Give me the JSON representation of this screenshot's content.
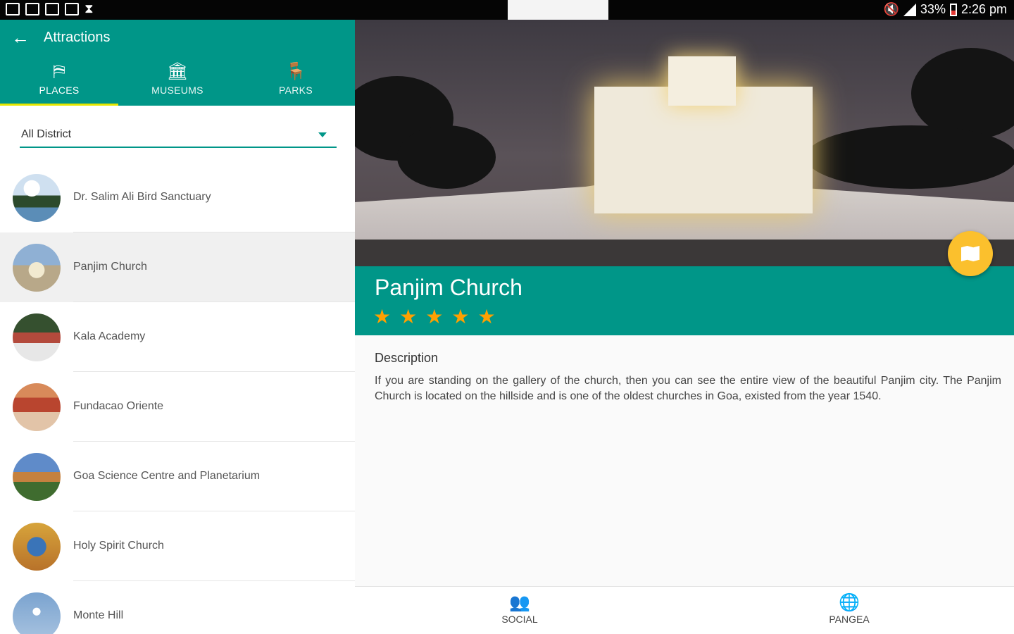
{
  "status": {
    "battery": "33%",
    "time": "2:26 pm"
  },
  "appbar": {
    "title": "Attractions"
  },
  "tabs": [
    {
      "label": "PLACES",
      "icon": "signpost-icon",
      "active": true
    },
    {
      "label": "MUSEUMS",
      "icon": "museum-icon",
      "active": false
    },
    {
      "label": "PARKS",
      "icon": "bench-icon",
      "active": false
    }
  ],
  "filter": {
    "selected": "All District"
  },
  "places": [
    {
      "name": "Dr. Salim Ali Bird Sanctuary"
    },
    {
      "name": "Panjim Church"
    },
    {
      "name": "Kala Academy"
    },
    {
      "name": "Fundacao Oriente"
    },
    {
      "name": "Goa Science Centre and Planetarium"
    },
    {
      "name": "Holy Spirit Church"
    },
    {
      "name": "Monte Hill"
    }
  ],
  "detail": {
    "title": "Panjim Church",
    "rating": 5,
    "description_label": "Description",
    "description": " If you are standing on the gallery of the church, then you can see the entire view of the beautiful Panjim city. The Panjim Church is located on the hillside and is one of the oldest churches in Goa, existed from the year 1540."
  },
  "bottom_nav": [
    {
      "label": "SOCIAL",
      "icon": "people-icon"
    },
    {
      "label": "PANGEA",
      "icon": "globe-icon"
    }
  ],
  "colors": {
    "primary": "#009688",
    "accent": "#fbc02d",
    "star": "#ffa000",
    "tab_indicator": "#e6e600"
  }
}
